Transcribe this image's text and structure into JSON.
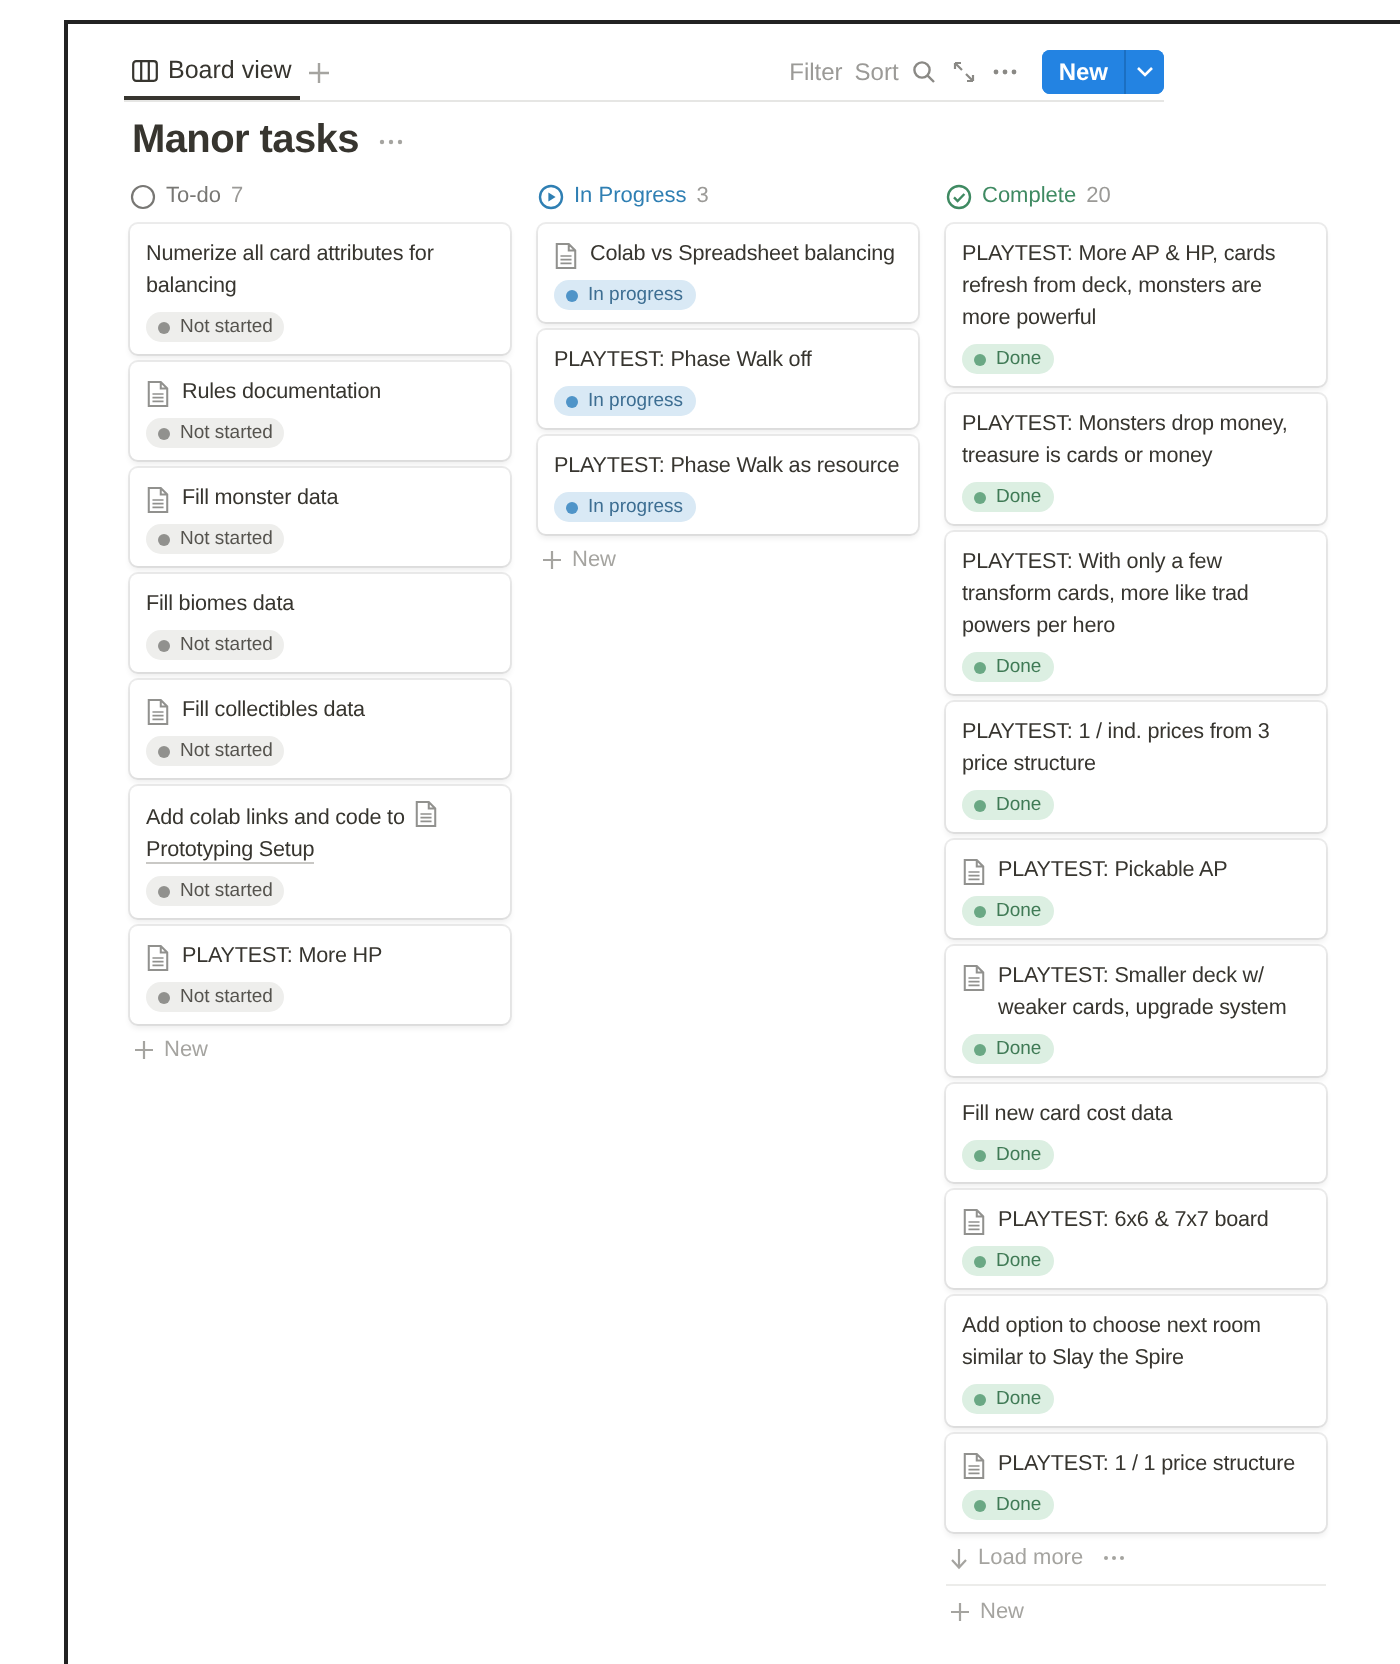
{
  "toolbar": {
    "view_tab": {
      "label": "Board view",
      "selected": true
    },
    "actions": [
      "Filter",
      "Sort"
    ],
    "new_button": "New"
  },
  "title": "Manor tasks",
  "columns": [
    {
      "kind": "todo",
      "name": "To-do",
      "count": "7",
      "cards": [
        {
          "title": "Numerize all card attributes for balancing",
          "page": false,
          "status": "Not started"
        },
        {
          "title": "Rules documentation",
          "page": true,
          "status": "Not started"
        },
        {
          "title": "Fill monster data",
          "page": true,
          "status": "Not started"
        },
        {
          "title": "Fill biomes data",
          "page": false,
          "status": "Not started"
        },
        {
          "title": "Fill collectibles data",
          "page": true,
          "status": "Not started"
        },
        {
          "title": "Add colab links and code to",
          "link": "Prototyping Setup",
          "page": false,
          "status": "Not started"
        },
        {
          "title": "PLAYTEST: More HP",
          "page": true,
          "status": "Not started"
        }
      ],
      "new_label": "New"
    },
    {
      "kind": "progress",
      "name": "In Progress",
      "count": "3",
      "cards": [
        {
          "title": "Colab vs Spreadsheet balancing",
          "page": true,
          "status": "In progress"
        },
        {
          "title": "PLAYTEST: Phase Walk off",
          "page": false,
          "status": "In progress"
        },
        {
          "title": "PLAYTEST: Phase Walk as resource",
          "page": false,
          "status": "In progress"
        }
      ],
      "new_label": "New"
    },
    {
      "kind": "done",
      "name": "Complete",
      "count": "20",
      "cards": [
        {
          "title": "PLAYTEST: More AP & HP, cards refresh from deck, monsters are more powerful",
          "page": false,
          "status": "Done"
        },
        {
          "title": "PLAYTEST: Monsters drop money, treasure is cards or money",
          "page": false,
          "status": "Done"
        },
        {
          "title": "PLAYTEST: With only a few transform cards, more like trad powers per hero",
          "page": false,
          "status": "Done"
        },
        {
          "title": "PLAYTEST: 1 / ind. prices from 3 price structure",
          "page": false,
          "status": "Done"
        },
        {
          "title": "PLAYTEST: Pickable AP",
          "page": true,
          "status": "Done"
        },
        {
          "title": "PLAYTEST: Smaller deck w/ weaker cards, upgrade system",
          "page": true,
          "status": "Done"
        },
        {
          "title": "Fill new card cost data",
          "page": false,
          "status": "Done"
        },
        {
          "title": "PLAYTEST: 6x6 & 7x7 board",
          "page": true,
          "status": "Done"
        },
        {
          "title": "Add option to choose next room similar to Slay the Spire",
          "page": false,
          "status": "Done"
        },
        {
          "title": "PLAYTEST: 1 / 1 price structure",
          "page": true,
          "status": "Done"
        }
      ],
      "load_more": "Load more",
      "new_label": "New"
    }
  ]
}
